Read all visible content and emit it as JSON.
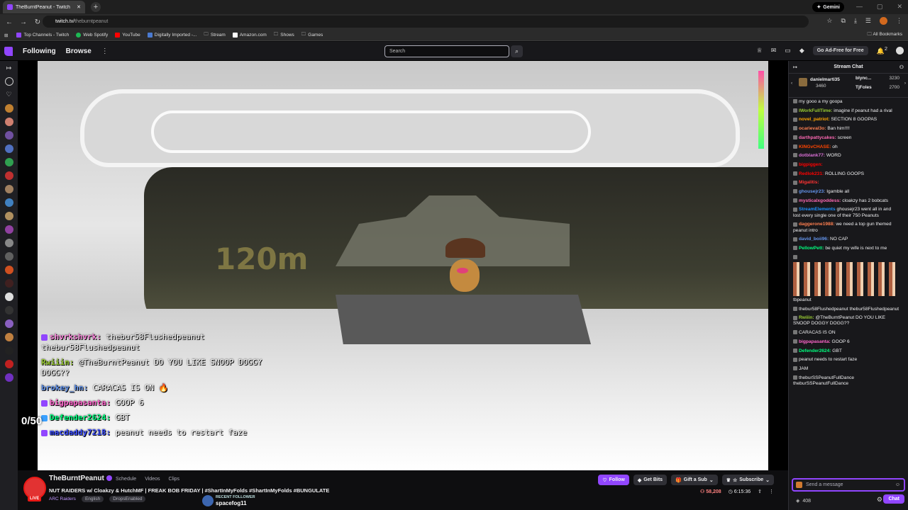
{
  "browser": {
    "tab_title": "TheBurntPeanut - Twitch",
    "gemini_label": "Gemini",
    "url_domain": "twitch.tv/",
    "url_path": "theburntpeanut",
    "bookmarks": [
      "Top Channels - Twitch",
      "Web Spotify",
      "YouTube",
      "Digitally Imported -...",
      "Stream",
      "Amazon.com",
      "Shows",
      "Games"
    ],
    "all_bookmarks": "All Bookmarks"
  },
  "topnav": {
    "following": "Following",
    "browse": "Browse",
    "search_placeholder": "Search",
    "adfree": "Go Ad-Free for Free",
    "notif_count": "2"
  },
  "overlay_chat": [
    {
      "user": "shvrkshvrk:",
      "color": "#ff8ae0",
      "text": "thebur58Flushedpeanut thebur58Flushedpeanut"
    },
    {
      "user": "Rwiiin:",
      "color": "#9acd32",
      "text": "@TheBurntPeanut DO YOU LIKE SNOOP DOGGY DOGG??"
    },
    {
      "user": "brokey_hn:",
      "color": "#6495ed",
      "text": "CARACAS IS ON"
    },
    {
      "user": "bigpapasanta:",
      "color": "#ff66cc",
      "text": "GOOP 6"
    },
    {
      "user": "Defender2624:",
      "color": "#00ff7f",
      "text": "GBT"
    },
    {
      "user": "macdaddy7218:",
      "color": "#3a4cff",
      "text": "peanut needs to restart faze"
    }
  ],
  "counter": "0/50",
  "stream": {
    "channel": "TheBurntPeanut",
    "live": "LIVE",
    "tabs": [
      "Schedule",
      "Videos",
      "Clips"
    ],
    "title": "NUT RAIDERS w/ Cloakzy & HutchMF | FREAK BOB FRIDAY | #ShartInMyFolds #ShartInMyFolds #BUNGULATE",
    "category": "ARC Raiders",
    "tags": [
      "English",
      "DropsEnabled"
    ],
    "recent_follower_label": "RECENT FOLLOWER",
    "recent_follower_name": "spacefog11",
    "follow": "Follow",
    "get_bits": "Get Bits",
    "gift_sub": "Gift a Sub",
    "subscribe": "Subscribe",
    "viewers": "58,208",
    "uptime": "6:15:36"
  },
  "scene": {
    "big_text": "120m"
  },
  "chat": {
    "header": "Stream Chat",
    "gifters": [
      {
        "name": "danielmarti35",
        "value": "3460"
      },
      {
        "name": "blync...",
        "value": "3230"
      },
      {
        "name": "TjFoles",
        "value": "2700"
      }
    ],
    "messages": [
      {
        "user": "",
        "color": "#3a4cff",
        "text": "my gooo a my goopa"
      },
      {
        "user": "IWorkFullTime:",
        "color": "#9acd32",
        "text": "imagine if peanut had a rival"
      },
      {
        "user": "novel_patriot:",
        "color": "#ffa500",
        "text": "SECTION 8 GOOPAS"
      },
      {
        "user": "ocarieval3o:",
        "color": "#ff7f50",
        "text": "Ban him!!!!"
      },
      {
        "user": "darthpattycakes:",
        "color": "#ff69b4",
        "text": "screen"
      },
      {
        "user": "KINGvCHASE:",
        "color": "#ff4500",
        "text": "oh"
      },
      {
        "user": "dotblank77:",
        "color": "#da70d6",
        "text": "WORD"
      },
      {
        "user": "bigpiggen:",
        "color": "#ff0000",
        "text": ""
      },
      {
        "user": "Redlok231:",
        "color": "#ff0000",
        "text": "ROLLING GOOPS"
      },
      {
        "user": "Migalitis:",
        "color": "#ff3333",
        "text": ""
      },
      {
        "user": "ghousejr23:",
        "color": "#6495ed",
        "text": "Igamble all"
      },
      {
        "user": "mysticalxgoddess:",
        "color": "#ff69b4",
        "text": "cloakzy has 2 bobcats"
      },
      {
        "user": "StreamElements",
        "color": "#1e90ff",
        "text": "ghousejr23 went all in and lost every single one of their 750 Peanuts"
      },
      {
        "user": "daggerone1988:",
        "color": "#ff7f50",
        "text": "we need a top gun themed peanut intro"
      },
      {
        "user": "david_boii96:",
        "color": "#6495ed",
        "text": "NO CAP"
      },
      {
        "user": "PellowPett:",
        "color": "#00ff7f",
        "text": "be quiet my wife is next to me"
      },
      {
        "user": "",
        "color": "#3a4cff",
        "text": "tbpeanut"
      },
      {
        "user": "",
        "color": "#3a4cff",
        "text": "thebur58Flushedpeanut thebur58Flushedpeanut"
      },
      {
        "user": "Rwiiin:",
        "color": "#9acd32",
        "text": "@TheBurntPeanut DO YOU LIKE SNOOP DOGGY DOGG??"
      },
      {
        "user": "",
        "color": "#3a4cff",
        "text": "CARACAS IS ON"
      },
      {
        "user": "bigpapasanta:",
        "color": "#ff66cc",
        "text": "GOOP 6"
      },
      {
        "user": "Defender2624:",
        "color": "#00ff7f",
        "text": "GBT"
      },
      {
        "user": "",
        "color": "#3a4cff",
        "text": "peanut needs to restart faze"
      },
      {
        "user": "",
        "color": "#3a4cff",
        "text": "JAM"
      },
      {
        "user": "",
        "color": "#3a4cff",
        "text": "theburSSPeanutFullDance theburSSPeanutFullDance"
      }
    ],
    "input_placeholder": "Send a message",
    "points": "408",
    "chat_button": "Chat"
  }
}
